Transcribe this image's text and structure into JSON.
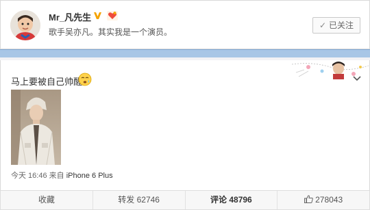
{
  "profile": {
    "username": "Mr_凡先生",
    "bio": "歌手吴亦凡。其实我是一个演员。",
    "follow_label": "已关注",
    "follow_check": "✓"
  },
  "post": {
    "text": "马上要被自己帅醒",
    "time": "今天 16:46",
    "source_prefix": "来自",
    "device": "iPhone 6 Plus"
  },
  "actions": {
    "favorite": "收藏",
    "repost_label": "转发",
    "repost_count": "62746",
    "comment_label": "评论",
    "comment_count": "48796",
    "like_count": "278043"
  },
  "colors": {
    "verified": "#f5a300",
    "link_blue": "#1a65b4",
    "strip_blue": "#a8c6e6"
  },
  "icons": {
    "verified": "verified-v-icon",
    "heart": "heart-badge-icon",
    "emoji": "sleepy-face-icon",
    "collapse": "chevron-down-icon",
    "like": "thumbs-up-icon"
  }
}
